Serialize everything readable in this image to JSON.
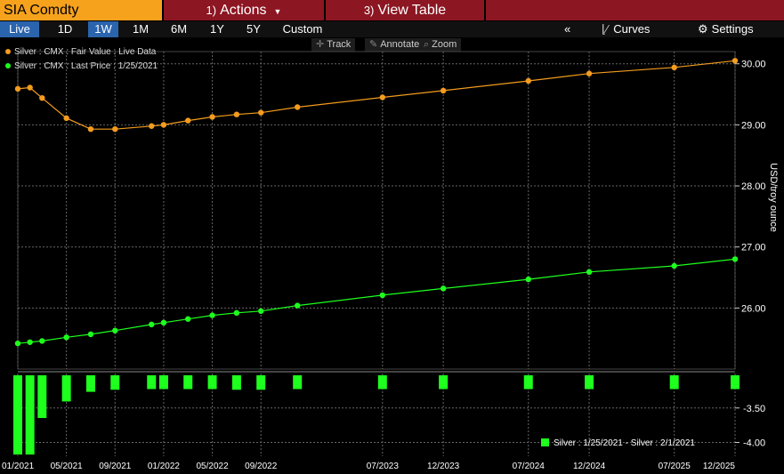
{
  "header": {
    "ticker": "SIA Comdty",
    "actions_num": "1)",
    "actions_label": "Actions",
    "viewtable_num": "3)",
    "viewtable_label": "View Table"
  },
  "toolbar": {
    "ranges": [
      "Live",
      "1D",
      "1W",
      "1M",
      "6M",
      "1Y",
      "5Y",
      "Custom"
    ],
    "active_ranges": [
      "Live",
      "1W"
    ],
    "collapse": "«",
    "curves": "Curves",
    "settings": "Settings"
  },
  "tools": {
    "track": "Track",
    "annotate": "Annotate",
    "zoom": "Zoom"
  },
  "colors": {
    "fair": "#f39c1e",
    "last": "#1eff1e",
    "grid": "#666666",
    "axis": "#ffffff"
  },
  "icons": [
    "crosshair-icon",
    "annotate-icon",
    "zoom-icon",
    "curves-icon",
    "gear-icon",
    "caret-down-icon"
  ],
  "chart_data": {
    "type": "line",
    "ylabel": "USD/troy ounce",
    "ylim": [
      25.0,
      30.2
    ],
    "yticks": [
      26.0,
      27.0,
      28.0,
      29.0,
      30.0
    ],
    "ytick_labels": [
      "26.00",
      "27.00",
      "28.00",
      "29.00",
      "30.00"
    ],
    "x_ticks": [
      {
        "month": "2021-01",
        "label": "01/2021"
      },
      {
        "month": "2021-05",
        "label": "05/2021"
      },
      {
        "month": "2021-09",
        "label": "09/2021"
      },
      {
        "month": "2022-01",
        "label": "01/2022"
      },
      {
        "month": "2022-05",
        "label": "05/2022"
      },
      {
        "month": "2022-09",
        "label": "09/2022"
      },
      {
        "month": "2023-07",
        "label": "07/2023"
      },
      {
        "month": "2023-12",
        "label": "12/2023"
      },
      {
        "month": "2024-07",
        "label": "07/2024"
      },
      {
        "month": "2024-12",
        "label": "12/2024"
      },
      {
        "month": "2025-07",
        "label": "07/2025"
      },
      {
        "month": "2025-12",
        "label": "12/2025"
      }
    ],
    "x": [
      "2021-01",
      "2021-02",
      "2021-03",
      "2021-05",
      "2021-07",
      "2021-09",
      "2021-12",
      "2022-01",
      "2022-03",
      "2022-05",
      "2022-07",
      "2022-09",
      "2022-12",
      "2023-07",
      "2023-12",
      "2024-07",
      "2024-12",
      "2025-07",
      "2025-12"
    ],
    "series": [
      {
        "name": "Silver : CMX : Fair Value : Live Data",
        "color": "#f39c1e",
        "values": [
          29.59,
          29.61,
          29.44,
          29.11,
          28.93,
          28.93,
          28.98,
          29.0,
          29.07,
          29.13,
          29.17,
          29.2,
          29.29,
          29.45,
          29.56,
          29.72,
          29.84,
          29.94,
          30.05
        ]
      },
      {
        "name": "Silver : CMX : Last Price : 1/25/2021",
        "color": "#1eff1e",
        "values": [
          25.42,
          25.44,
          25.46,
          25.52,
          25.57,
          25.63,
          25.73,
          25.76,
          25.82,
          25.88,
          25.92,
          25.95,
          26.04,
          26.21,
          26.32,
          26.47,
          26.59,
          26.69,
          26.8
        ]
      }
    ],
    "lower": {
      "type": "bar",
      "name": "Silver : 1/25/2021 - Silver : 2/1/2021",
      "color": "#1eff1e",
      "ylim": [
        -4.2,
        -3.0
      ],
      "yticks": [
        -3.5,
        -4.0
      ],
      "ytick_labels": [
        "-3.50",
        "-4.00"
      ],
      "values": [
        -4.15,
        -4.15,
        -3.62,
        -3.38,
        -3.24,
        -3.21,
        -3.2,
        -3.2,
        -3.2,
        -3.2,
        -3.21,
        -3.21,
        -3.2,
        -3.2,
        -3.2,
        -3.2,
        -3.2,
        -3.2,
        -3.2
      ]
    }
  }
}
